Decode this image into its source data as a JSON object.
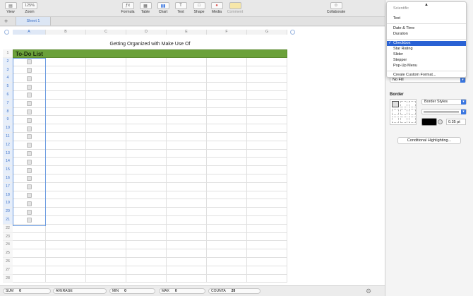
{
  "toolbar": {
    "view": "View",
    "zoom_value": "125%",
    "zoom": "Zoom",
    "formula": "Formula",
    "table": "Table",
    "chart": "Chart",
    "text": "Text",
    "shape": "Shape",
    "media": "Media",
    "comment": "Comment",
    "collaborate": "Collaborate"
  },
  "tabs": {
    "sheet1": "Sheet 1"
  },
  "sheet": {
    "title": "Getting Organized with Make Use Of",
    "columns": [
      "A",
      "B",
      "C",
      "D",
      "E",
      "F",
      "G"
    ],
    "header_text": "To-Do List",
    "rows": [
      "1",
      "2",
      "3",
      "4",
      "5",
      "6",
      "7",
      "8",
      "9",
      "10",
      "11",
      "12",
      "13",
      "14",
      "15",
      "16",
      "17",
      "18",
      "19",
      "20",
      "21",
      "22",
      "23",
      "24",
      "25",
      "26",
      "27",
      "28"
    ]
  },
  "status": {
    "sum_label": "SUM",
    "sum_value": "0",
    "avg_label": "AVERAGE",
    "avg_value": "",
    "min_label": "MIN",
    "min_value": "0",
    "max_label": "MAX",
    "max_value": "0",
    "counta_label": "COUNTA",
    "counta_value": "20"
  },
  "menu": {
    "cut_item": "Scientific",
    "items_a": [
      "Text"
    ],
    "items_b": [
      "Date & Time",
      "Duration"
    ],
    "selected": "Checkbox",
    "items_c": [
      "Star Rating",
      "Slider",
      "Stepper",
      "Pop-Up Menu"
    ],
    "custom": "Create Custom Format..."
  },
  "sidebar": {
    "fill_value": "No Fill",
    "border_label": "Border",
    "border_styles": "Border Styles",
    "stroke_width": "0.35 pt",
    "conditional": "Conditional Highlighting..."
  },
  "colors": {
    "header_green": "#6ba13a",
    "accent": "#2a62d4"
  }
}
